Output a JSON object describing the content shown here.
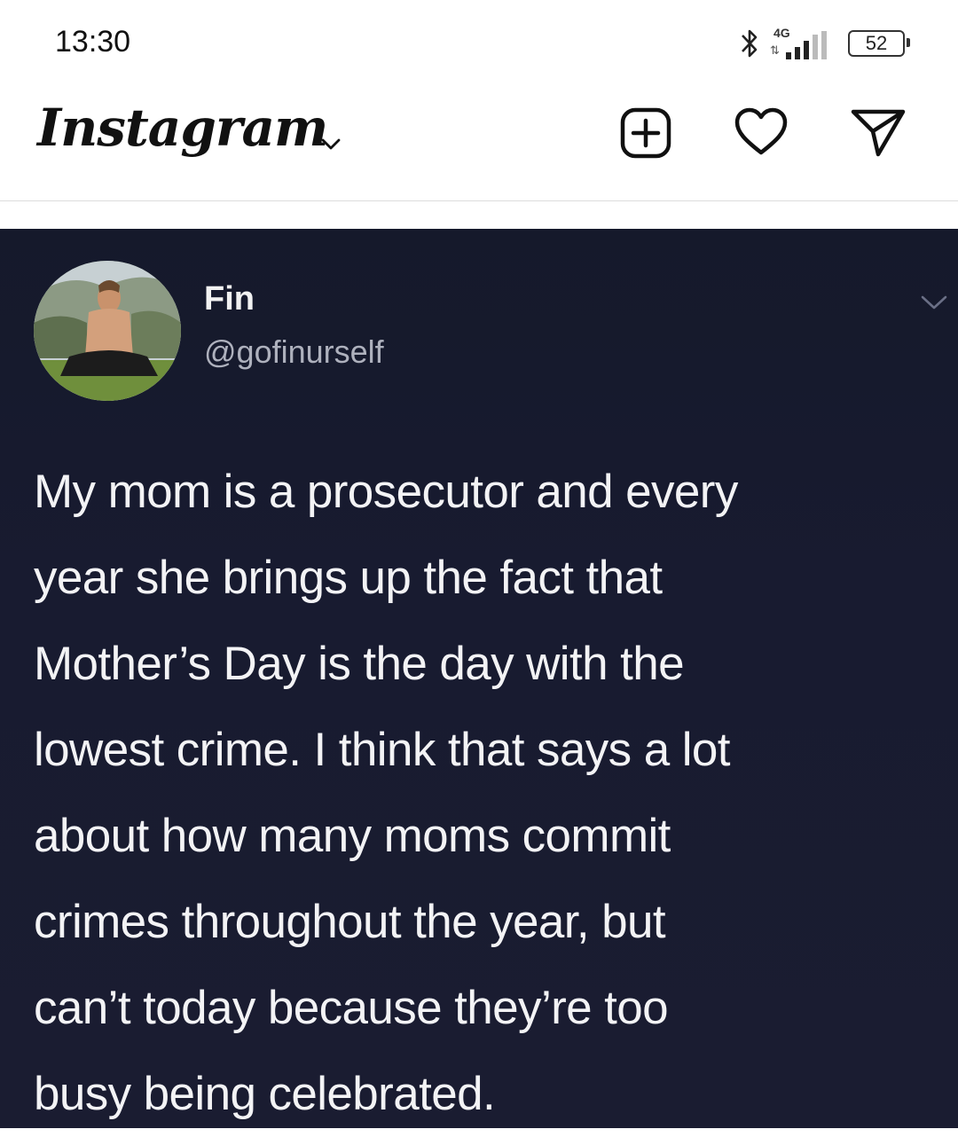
{
  "status_bar": {
    "time": "13:30",
    "network": "4G",
    "battery": "52",
    "icons": [
      "bluetooth-icon",
      "signal-icon",
      "battery-icon"
    ]
  },
  "header": {
    "app_name": "Instagram",
    "icons": [
      "chevron-down-icon",
      "new-post-icon",
      "heart-icon",
      "send-icon"
    ]
  },
  "post": {
    "author_name": "Fin",
    "author_handle": "@gofinurself",
    "text": "My mom is a prosecutor and every\nyear she brings up the fact that\nMother’s Day is the day with the\nlowest crime. I think that says a lot\nabout how many moms commit\ncrimes throughout the year, but\ncan’t today because they’re too\nbusy being celebrated."
  },
  "colors": {
    "post_background": "#181b30",
    "post_text": "#f3f3f5",
    "handle_text": "#aeb1bd"
  }
}
